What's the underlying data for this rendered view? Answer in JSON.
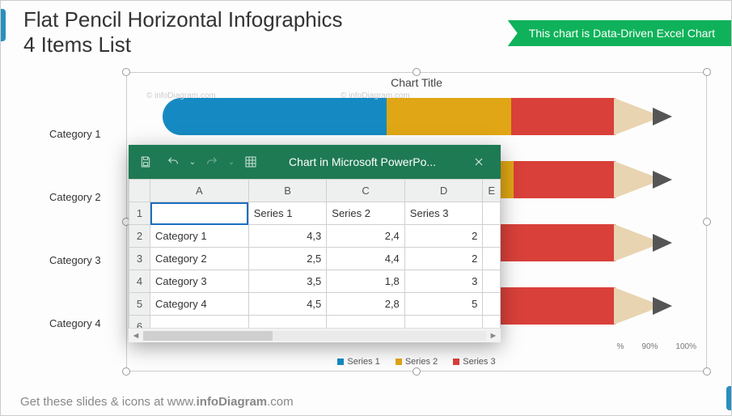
{
  "slide": {
    "title": "Flat Pencil Horizontal Infographics",
    "subtitle": "4 Items List",
    "ribbon": "This chart is Data-Driven Excel Chart",
    "footer_prefix": "Get these slides & icons at www.",
    "footer_bold": "infoDiagram",
    "footer_suffix": ".com",
    "watermark": "© infoDiagram.com"
  },
  "chart": {
    "title": "Chart Title",
    "categories": [
      "Category 1",
      "Category 2",
      "Category 3",
      "Category 4"
    ],
    "legend": [
      "Series 1",
      "Series 2",
      "Series 3"
    ],
    "colors": {
      "s1": "#158ac2",
      "s2": "#e0a615",
      "s3": "#d9403a"
    },
    "axis_ticks": [
      "%",
      "90%",
      "100%"
    ]
  },
  "excel": {
    "window_title": "Chart in Microsoft PowerPo...",
    "columns": [
      "A",
      "B",
      "C",
      "D",
      "E"
    ],
    "headers": [
      "",
      "Series 1",
      "Series 2",
      "Series 3"
    ],
    "rows": [
      {
        "n": "2",
        "cat": "Category 1",
        "s1": "4,3",
        "s2": "2,4",
        "s3": "2"
      },
      {
        "n": "3",
        "cat": "Category 2",
        "s1": "2,5",
        "s2": "4,4",
        "s3": "2"
      },
      {
        "n": "4",
        "cat": "Category 3",
        "s1": "3,5",
        "s2": "1,8",
        "s3": "3"
      },
      {
        "n": "5",
        "cat": "Category 4",
        "s1": "4,5",
        "s2": "2,8",
        "s3": "5"
      }
    ],
    "empty_row": "6"
  },
  "chart_data": {
    "type": "bar",
    "orientation": "horizontal-stacked-100",
    "categories": [
      "Category 1",
      "Category 2",
      "Category 3",
      "Category 4"
    ],
    "series": [
      {
        "name": "Series 1",
        "values": [
          4.3,
          2.5,
          3.5,
          4.5
        ],
        "color": "#158ac2"
      },
      {
        "name": "Series 2",
        "values": [
          2.4,
          4.4,
          1.8,
          2.8
        ],
        "color": "#e0a615"
      },
      {
        "name": "Series 3",
        "values": [
          2.0,
          2.0,
          3.0,
          5.0
        ],
        "color": "#d9403a"
      }
    ],
    "title": "Chart Title",
    "xlabel": "",
    "ylabel": "",
    "xlim": [
      0,
      100
    ]
  }
}
